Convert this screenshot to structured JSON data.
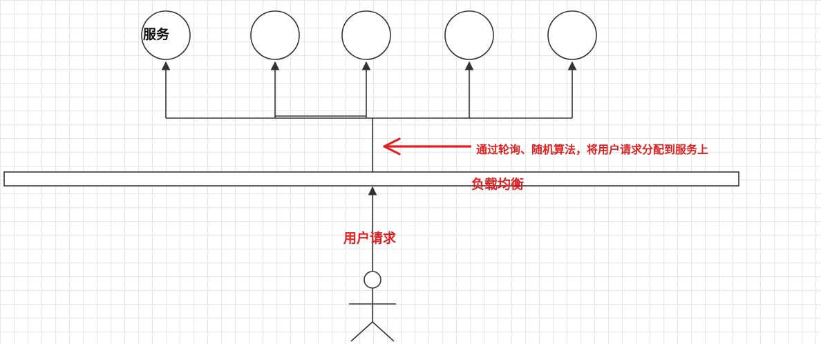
{
  "diagram": {
    "service_label": "服务",
    "annotation": "通过轮询、随机算法，将用户请求分配到服务上",
    "load_balancer_label": "负载均衡",
    "user_request_label": "用户请求",
    "service_count": 5,
    "colors": {
      "line": "#333333",
      "accent": "#e02020",
      "grid": "#e6e6e6"
    }
  }
}
